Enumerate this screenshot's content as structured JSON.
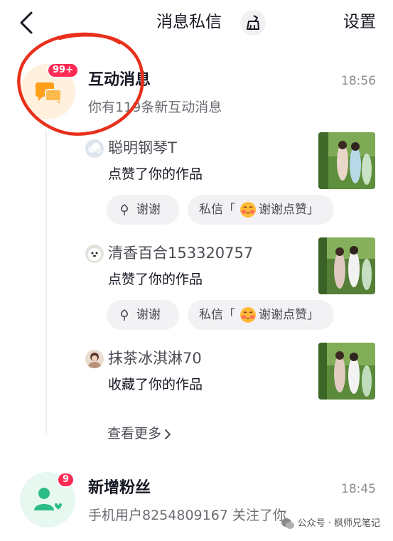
{
  "header": {
    "title": "消息私信",
    "settings_label": "设置",
    "back_icon": "chevron-left-icon",
    "clean_icon": "broom-icon"
  },
  "interactions": {
    "title": "互动消息",
    "time": "18:56",
    "badge": "99+",
    "subtitle": "你有119条新互动消息",
    "icon": "chat-bubbles-icon",
    "icon_color": "#ff9f1a",
    "entries": [
      {
        "name": "聪明钢琴T",
        "action": "点赞了你的作品",
        "thanks_label": "谢谢",
        "dm_label": "私信「",
        "dm_text": "谢谢点赞」"
      },
      {
        "name": "清香百合153320757",
        "action": "点赞了你的作品",
        "thanks_label": "谢谢",
        "dm_label": "私信「",
        "dm_text": "谢谢点赞」"
      },
      {
        "name": "抹茶冰淇淋70",
        "action": "收藏了你的作品"
      }
    ],
    "more_label": "查看更多"
  },
  "followers": {
    "title": "新增粉丝",
    "time": "18:45",
    "badge": "9",
    "subtitle": "手机用户8254809167 关注了你",
    "icon": "user-heart-icon",
    "icon_color": "#2dbd87"
  },
  "watermark": "公众号 · 枫师兄笔记",
  "colors": {
    "badge": "#fe2c55",
    "annotation": "#e8301c"
  }
}
